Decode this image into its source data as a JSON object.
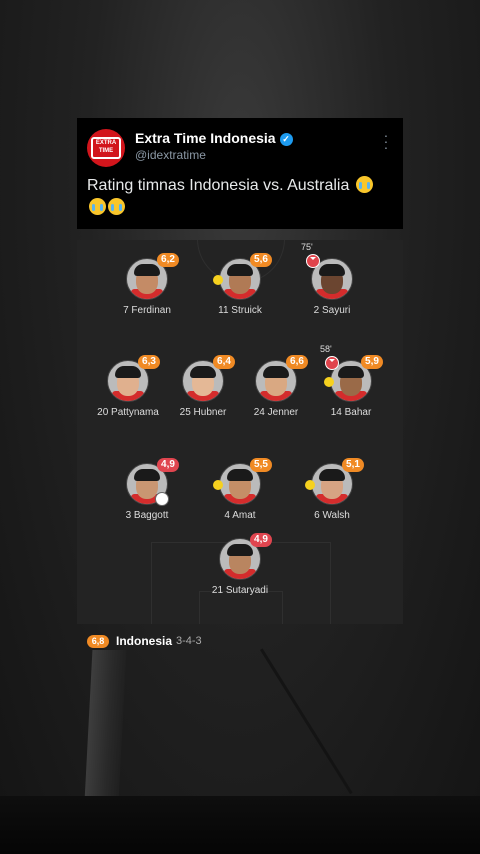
{
  "tweet": {
    "account_name": "Extra Time Indonesia",
    "verified_icon": "verified-badge-icon",
    "handle": "@idextratime",
    "avatar_text": "EXTRA TIME",
    "text": "Rating timnas Indonesia vs. Australia",
    "emoji": "loudly-crying-face"
  },
  "colors": {
    "rating_orange": "#f08a24",
    "rating_red": "#e0454f",
    "brand_red": "#d2151c",
    "verified_blue": "#1d9bf0"
  },
  "lineup": {
    "team": "Indonesia",
    "formation": "3-4-3",
    "team_rating": "6,8",
    "players": [
      {
        "label": "7 Ferdinan",
        "rating": "6,2",
        "tier": "orange"
      },
      {
        "label": "11 Struick",
        "rating": "5,6",
        "tier": "orange",
        "yellow_card": true
      },
      {
        "label": "2 Sayuri",
        "rating": "",
        "tier": "",
        "sub_out": true,
        "sub_minute": "75'"
      },
      {
        "label": "20 Pattynama",
        "rating": "6,3",
        "tier": "orange"
      },
      {
        "label": "25 Hubner",
        "rating": "6,4",
        "tier": "orange"
      },
      {
        "label": "24 Jenner",
        "rating": "6,6",
        "tier": "orange"
      },
      {
        "label": "14 Bahar",
        "rating": "5,9",
        "tier": "orange",
        "yellow_card": true,
        "sub_out": true,
        "sub_minute": "58'"
      },
      {
        "label": "3 Baggott",
        "rating": "4,9",
        "tier": "red",
        "own_goal": true
      },
      {
        "label": "4 Amat",
        "rating": "5,5",
        "tier": "orange",
        "yellow_card": true
      },
      {
        "label": "6 Walsh",
        "rating": "5,1",
        "tier": "orange",
        "yellow_card": true
      },
      {
        "label": "21 Sutaryadi",
        "rating": "4,9",
        "tier": "red"
      }
    ]
  }
}
